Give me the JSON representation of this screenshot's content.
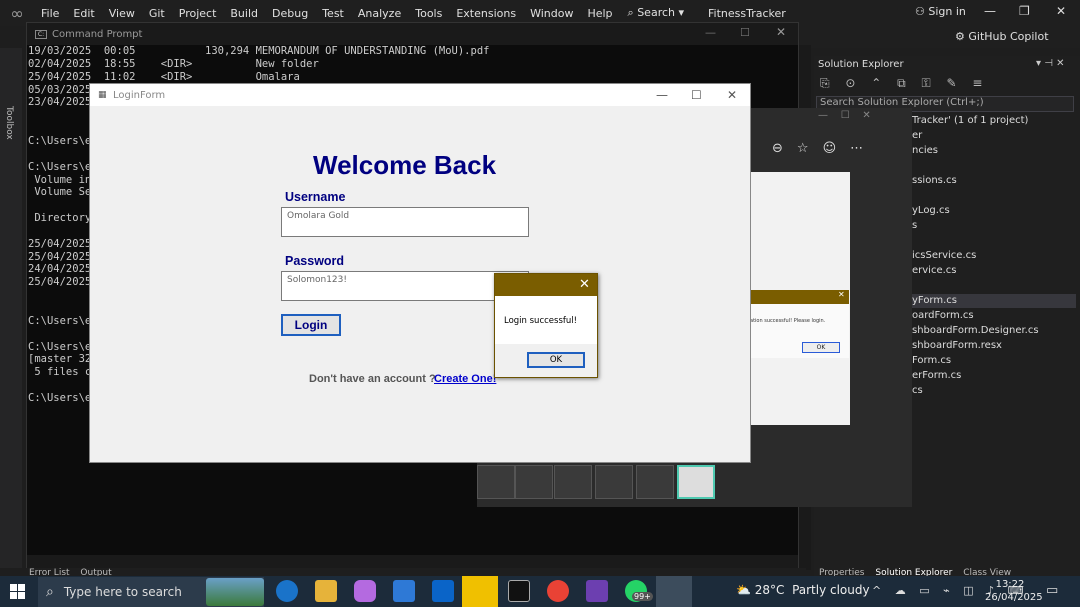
{
  "vs": {
    "menus": [
      "File",
      "Edit",
      "View",
      "Git",
      "Project",
      "Build",
      "Debug",
      "Test",
      "Analyze",
      "Tools",
      "Extensions",
      "Window",
      "Help"
    ],
    "search_label": "Search",
    "project": "FitnessTracker",
    "signin": "Sign in",
    "copilot": "GitHub Copilot",
    "toolbox": "Toolbox",
    "bottom_tabs": [
      "Error List",
      "Output"
    ]
  },
  "cmd": {
    "title": "Command Prompt",
    "lines": [
      "19/03/2025  00:05           130,294 MEMORANDUM OF UNDERSTANDING (MoU).pdf",
      "02/04/2025  18:55    <DIR>          New folder",
      "25/04/2025  11:02    <DIR>          Omalara",
      "05/03/2025",
      "23/04/2025",
      "",
      "",
      "C:\\Users\\e",
      "",
      "C:\\Users\\e",
      " Volume in",
      " Volume Se",
      "",
      " Directory",
      "",
      "25/04/2025",
      "25/04/2025",
      "24/04/2025",
      "25/04/2025",
      "",
      "",
      "C:\\Users\\e",
      "",
      "C:\\Users\\e",
      "[master 32",
      " 5 files c",
      "",
      "C:\\Users\\e"
    ]
  },
  "solution_explorer": {
    "title": "Solution Explorer",
    "search_placeholder": "Search Solution Explorer (Ctrl+;)",
    "items": [
      "Tracker' (1 of 1 project)",
      "er",
      "ncies",
      "ssions.cs",
      "yLog.cs",
      "s",
      "icsService.cs",
      "ervice.cs",
      "yForm.cs",
      "oardForm.cs",
      "shboardForm.Designer.cs",
      "shboardForm.resx",
      "Form.cs",
      "erForm.cs",
      "cs"
    ],
    "tabs": [
      "Properties",
      "Solution Explorer",
      "Class View"
    ]
  },
  "photos": {
    "dialog_text": "ation successful! Please login.",
    "ok": "OK"
  },
  "login": {
    "window_title": "LoginForm",
    "heading": "Welcome Back",
    "username_label": "Username",
    "username_value": "Omolara Gold",
    "password_label": "Password",
    "password_value": "Solomon123!",
    "login_button": "Login",
    "no_account": "Don't have an account ?",
    "create_link": "Create One!"
  },
  "message_box": {
    "text": "Login successful!",
    "ok": "OK"
  },
  "taskbar": {
    "search_placeholder": "Type here to search",
    "weather_temp": "28°C",
    "weather_text": "Partly cloudy",
    "time": "13:22",
    "date": "26/04/2025",
    "whatsapp_badge": "99+"
  },
  "colors": {
    "heading": "#000080",
    "dialog_title": "#7a5d00",
    "link": "#0000cc",
    "taskbar": "#1c2b3a"
  }
}
